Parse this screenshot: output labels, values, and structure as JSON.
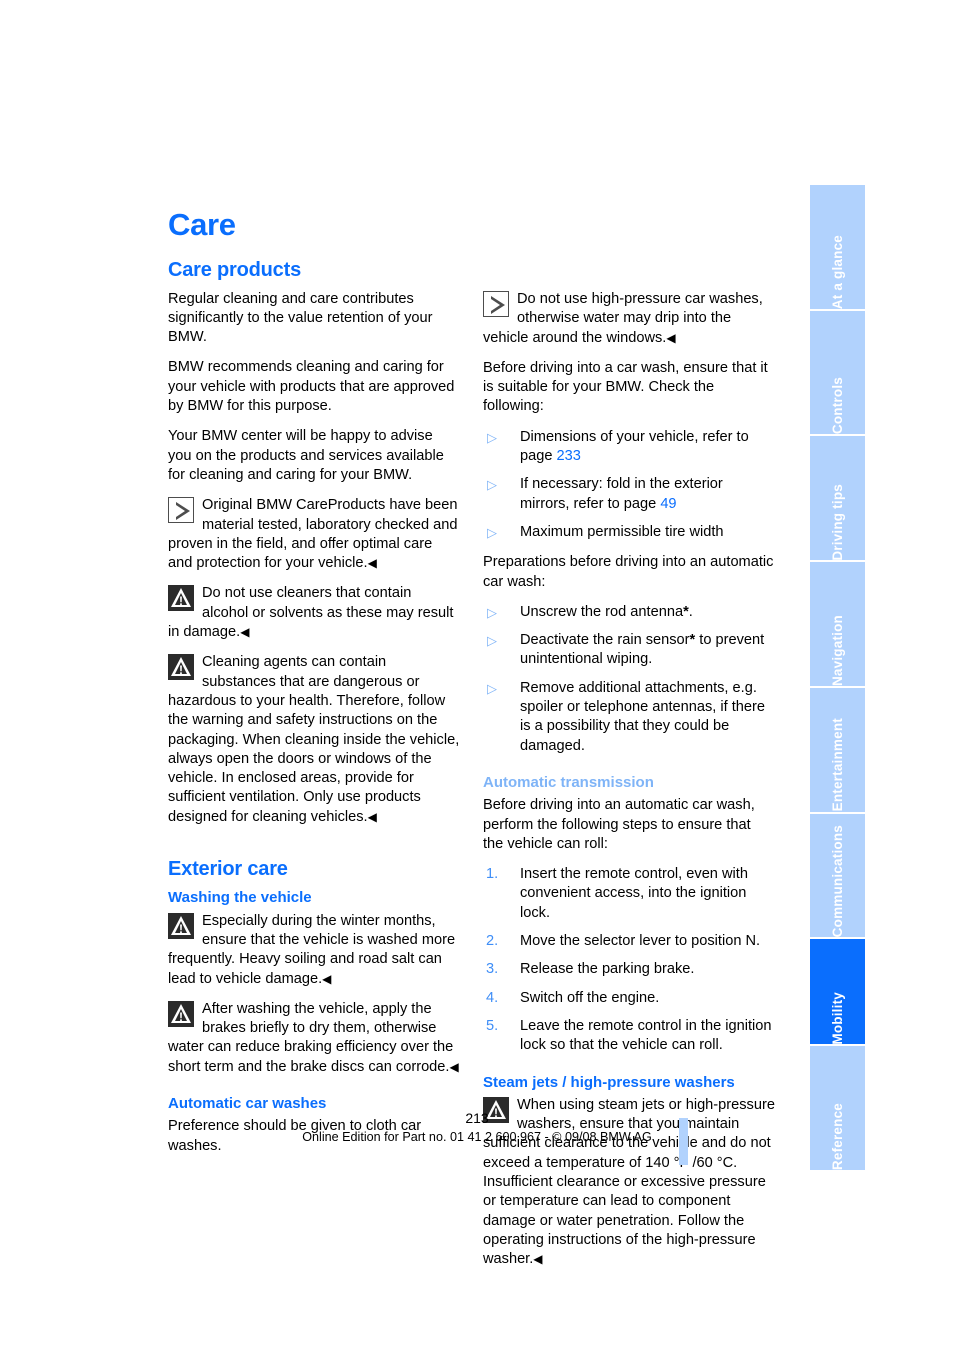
{
  "document": {
    "chapter_title": "Care",
    "page_number": "213",
    "imprint": "Online Edition for Part no. 01 41 2 600 967  - © 09/08 BMW AG"
  },
  "sidebar": {
    "tabs": [
      {
        "label": "At a glance",
        "active": false
      },
      {
        "label": "Controls",
        "active": false
      },
      {
        "label": "Driving tips",
        "active": false
      },
      {
        "label": "Navigation",
        "active": false
      },
      {
        "label": "Entertainment",
        "active": false
      },
      {
        "label": "Communications",
        "active": false
      },
      {
        "label": "Mobility",
        "active": true
      },
      {
        "label": "Reference",
        "active": false
      }
    ]
  },
  "left_column": {
    "section_care_products": {
      "heading": "Care products",
      "para1": "Regular cleaning and care contributes significantly to the value retention of your BMW.",
      "para2": "BMW recommends cleaning and caring for your vehicle with products that are approved by BMW for this purpose.",
      "para3": "Your BMW center will be happy to advise you on the products and services available for cleaning and caring for your BMW.",
      "note_info": "Original BMW CareProducts have been material tested, laboratory checked and proven in the field, and offer optimal care and protection for your vehicle.",
      "note_warn1": "Do not use cleaners that contain alcohol or solvents as these may result in damage.",
      "note_warn2": "Cleaning agents can contain substances that are dangerous or hazardous to your health. Therefore, follow the warning and safety instructions on the packaging. When cleaning inside the vehicle, always open the doors or windows of the vehicle. In enclosed areas, provide for sufficient ventilation. Only use products designed for cleaning vehicles."
    },
    "section_exterior_care": {
      "heading": "Exterior care",
      "sub_washing": {
        "heading": "Washing the vehicle",
        "note_warn1": "Especially during the winter months, ensure that the vehicle is washed more frequently. Heavy soiling and road salt can lead to vehicle damage.",
        "note_warn2": "After washing the vehicle, apply the brakes briefly to dry them, otherwise water can reduce braking efficiency over the short term and the brake discs can corrode."
      },
      "sub_automatic_car_washes": {
        "heading": "Automatic car washes",
        "para1": "Preference should be given to cloth car washes."
      }
    }
  },
  "right_column": {
    "note_info": "Do not use high-pressure car washes, otherwise water may drip into the vehicle around the windows.",
    "para_before_driving": "Before driving into a car wash, ensure that it is suitable for your BMW. Check the following:",
    "checklist": [
      {
        "text_before": "Dimensions of your vehicle, refer to page ",
        "ref": "233",
        "text_after": ""
      },
      {
        "text_before": "If necessary: fold in the exterior mirrors, refer to page ",
        "ref": "49",
        "text_after": ""
      },
      {
        "text_before": "Maximum permissible tire width",
        "ref": "",
        "text_after": ""
      }
    ],
    "para_preparations": "Preparations before driving into an automatic car wash:",
    "preparations": [
      {
        "text_before": "Unscrew the rod antenna",
        "star": "*",
        "text_after": "."
      },
      {
        "text_before": "Deactivate the rain sensor",
        "star": "*",
        "text_after": " to prevent unintentional wiping."
      },
      {
        "text_before": "Remove additional attachments, e.g. spoiler or telephone antennas, if there is a possibility that they could be damaged.",
        "star": "",
        "text_after": ""
      }
    ],
    "section_automatic_transmission": {
      "heading": "Automatic transmission",
      "para1": "Before driving into an automatic car wash, perform the following steps to ensure that the vehicle can roll:",
      "steps": [
        {
          "num": "1.",
          "text": "Insert the remote control, even with convenient access, into the ignition lock."
        },
        {
          "num": "2.",
          "text": "Move the selector lever to position N."
        },
        {
          "num": "3.",
          "text": "Release the parking brake."
        },
        {
          "num": "4.",
          "text": "Switch off the engine."
        },
        {
          "num": "5.",
          "text": "Leave the remote control in the ignition lock so that the vehicle can roll."
        }
      ]
    },
    "section_steam_jets": {
      "heading": "Steam jets / high-pressure washers",
      "note_warn": "When using steam jets or high-pressure washers, ensure that you maintain sufficient clearance to the vehicle and do not exceed a temperature of 140 °F /60 °C.",
      "note_warn_cont": "Insufficient clearance or excessive pressure or temperature can lead to component damage or water penetration. Follow the operating instructions of the high-pressure washer."
    }
  },
  "symbols": {
    "end_mark": "◀",
    "bullet_triangle": "▷"
  },
  "colors": {
    "accent_blue": "#0a6efd",
    "light_blue": "#b1d2fd",
    "mid_blue": "#7fb4f7"
  }
}
